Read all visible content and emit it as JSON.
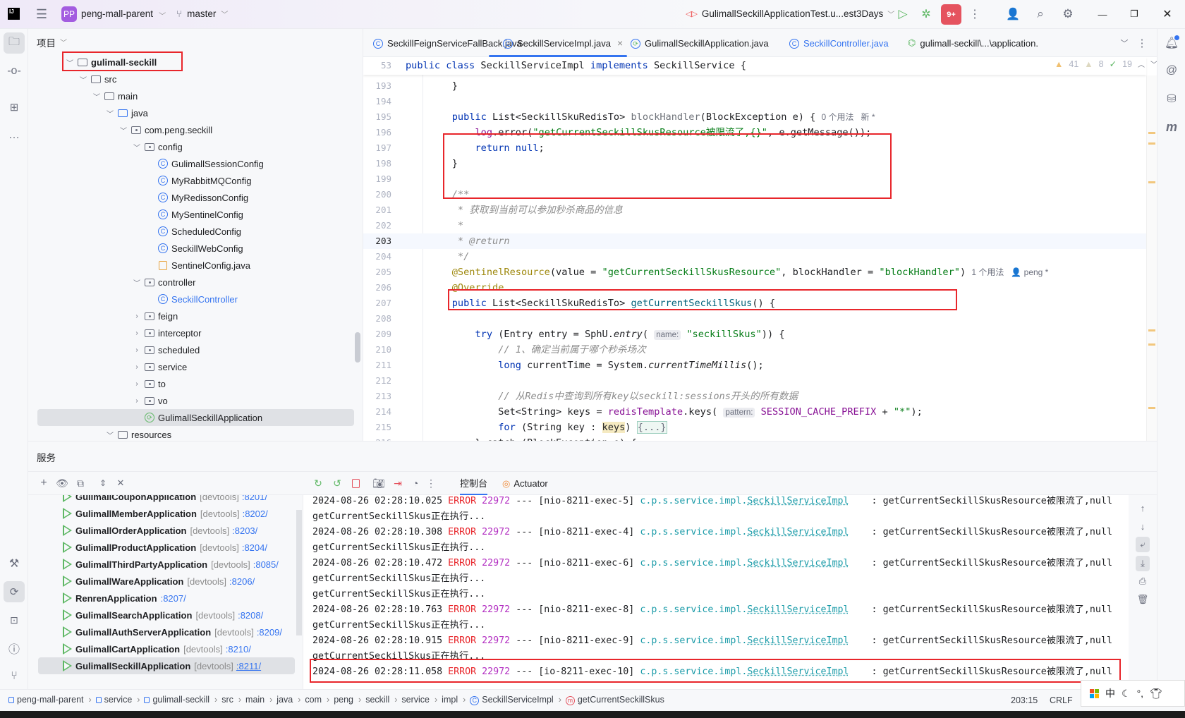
{
  "titlebar": {
    "avatar": "PP",
    "project": "peng-mall-parent",
    "branch": "master",
    "run_config": "GulimallSeckillApplicationTest.u...est3Days",
    "badge": "9+",
    "icons": [
      "intellij-logo",
      "hamburger-menu",
      "branch",
      "run",
      "debug",
      "more",
      "add-user",
      "search",
      "settings",
      "minimize",
      "restore",
      "close"
    ]
  },
  "project_panel": {
    "title": "项目",
    "tree": [
      {
        "depth": 0,
        "label": "gulimall-seckill",
        "type": "module",
        "open": true,
        "bold": true
      },
      {
        "depth": 1,
        "label": "src",
        "type": "folder",
        "open": true
      },
      {
        "depth": 2,
        "label": "main",
        "type": "folder",
        "open": true
      },
      {
        "depth": 3,
        "label": "java",
        "type": "srcfolder",
        "open": true
      },
      {
        "depth": 4,
        "label": "com.peng.seckill",
        "type": "package",
        "open": true
      },
      {
        "depth": 5,
        "label": "config",
        "type": "package",
        "open": true
      },
      {
        "depth": 6,
        "label": "GulimallSessionConfig",
        "type": "class"
      },
      {
        "depth": 6,
        "label": "MyRabbitMQConfig",
        "type": "class"
      },
      {
        "depth": 6,
        "label": "MyRedissonConfig",
        "type": "class"
      },
      {
        "depth": 6,
        "label": "MySentinelConfig",
        "type": "class"
      },
      {
        "depth": 6,
        "label": "ScheduledConfig",
        "type": "class"
      },
      {
        "depth": 6,
        "label": "SeckillWebConfig",
        "type": "class"
      },
      {
        "depth": 6,
        "label": "SentinelConfig.java",
        "type": "javafile"
      },
      {
        "depth": 5,
        "label": "controller",
        "type": "package",
        "open": true
      },
      {
        "depth": 6,
        "label": "SeckillController",
        "type": "class",
        "modified": true
      },
      {
        "depth": 5,
        "label": "feign",
        "type": "package",
        "open": false
      },
      {
        "depth": 5,
        "label": "interceptor",
        "type": "package",
        "open": false
      },
      {
        "depth": 5,
        "label": "scheduled",
        "type": "package",
        "open": false
      },
      {
        "depth": 5,
        "label": "service",
        "type": "package",
        "open": false
      },
      {
        "depth": 5,
        "label": "to",
        "type": "package",
        "open": false
      },
      {
        "depth": 5,
        "label": "vo",
        "type": "package",
        "open": false
      },
      {
        "depth": 5,
        "label": "GulimallSeckillApplication",
        "type": "springboot",
        "selected": true
      },
      {
        "depth": 3,
        "label": "resources",
        "type": "folder",
        "open": true
      }
    ]
  },
  "editor": {
    "tabs": [
      {
        "label": "SeckillFeignServiceFallBack.java",
        "icon": "class"
      },
      {
        "label": "SeckillServiceImpl.java",
        "icon": "class",
        "active": true
      },
      {
        "label": "GulimallSeckillApplication.java",
        "icon": "springboot"
      },
      {
        "label": "SeckillController.java",
        "icon": "class",
        "modified": true
      },
      {
        "label": "gulimall-seckill\\...\\application.",
        "icon": "yaml"
      }
    ],
    "inspections": {
      "warnings": "41",
      "weak_warnings": "8",
      "typos": "19"
    },
    "sticky_line": {
      "num": "53",
      "tokens": [
        [
          "public class ",
          "kw"
        ],
        [
          "SeckillServiceImpl ",
          ""
        ],
        [
          "implements ",
          "kw"
        ],
        [
          "SeckillService {",
          ""
        ]
      ]
    },
    "lines": [
      {
        "num": "193",
        "tokens": [
          [
            "    }",
            ""
          ]
        ]
      },
      {
        "num": "194",
        "tokens": []
      },
      {
        "num": "195",
        "tokens": [
          [
            "    public ",
            "kw"
          ],
          [
            "List<SeckillSkuRedisTo> ",
            ""
          ],
          [
            "blockHandler",
            "gray"
          ],
          [
            "(BlockException e) { ",
            ""
          ],
          [
            "0 个用法   新 *",
            "hintc"
          ]
        ]
      },
      {
        "num": "196",
        "tokens": [
          [
            "        ",
            ""
          ],
          [
            "log",
            "fld"
          ],
          [
            ".error(",
            ""
          ],
          [
            "\"getCurrentSeckillSkusResource被限流了,{}\"",
            "str"
          ],
          [
            ", e.getMessage());",
            ""
          ]
        ]
      },
      {
        "num": "197",
        "tokens": [
          [
            "        return null",
            "kw"
          ],
          [
            ";",
            ""
          ]
        ]
      },
      {
        "num": "198",
        "tokens": [
          [
            "    }",
            ""
          ]
        ]
      },
      {
        "num": "199",
        "tokens": []
      },
      {
        "num": "200",
        "tokens": [
          [
            "    /**",
            "cm"
          ]
        ]
      },
      {
        "num": "201",
        "tokens": [
          [
            "     * 获取到当前可以参加秒杀商品的信息",
            "cm"
          ]
        ]
      },
      {
        "num": "202",
        "tokens": [
          [
            "     *",
            "cm"
          ]
        ]
      },
      {
        "num": "203",
        "tokens": [
          [
            "     * ",
            "cm"
          ],
          [
            "@return",
            "cm"
          ]
        ],
        "current": true
      },
      {
        "num": "204",
        "tokens": [
          [
            "     */",
            "cm"
          ]
        ]
      },
      {
        "num": "205",
        "tokens": [
          [
            "    @SentinelResource",
            "ann"
          ],
          [
            "(value = ",
            ""
          ],
          [
            "\"getCurrentSeckillSkusResource\"",
            "str"
          ],
          [
            ", blockHandler = ",
            ""
          ],
          [
            "\"blockHandler\"",
            "str"
          ],
          [
            ") ",
            ""
          ],
          [
            "1 个用法   👤 peng *",
            "hintc"
          ]
        ]
      },
      {
        "num": "206",
        "tokens": [
          [
            "    @Override",
            "ann"
          ]
        ]
      },
      {
        "num": "207",
        "tokens": [
          [
            "    public ",
            "kw"
          ],
          [
            "List<SeckillSkuRedisTo> ",
            ""
          ],
          [
            "getCurrentSeckillSkus",
            "fn"
          ],
          [
            "() {",
            ""
          ]
        ]
      },
      {
        "num": "208",
        "tokens": []
      },
      {
        "num": "209",
        "tokens": [
          [
            "        try",
            "kw"
          ],
          [
            " (Entry entry = SphU.",
            ""
          ],
          [
            "entry",
            "it"
          ],
          [
            "( ",
            ""
          ],
          [
            "name:",
            "phint"
          ],
          [
            " ",
            ""
          ],
          [
            "\"seckillSkus\"",
            "str"
          ],
          [
            ")) {",
            ""
          ]
        ]
      },
      {
        "num": "210",
        "tokens": [
          [
            "            // 1、确定当前属于哪个秒杀场次",
            "cm"
          ]
        ]
      },
      {
        "num": "211",
        "tokens": [
          [
            "            long",
            "kw"
          ],
          [
            " currentTime = System.",
            ""
          ],
          [
            "currentTimeMillis",
            "it"
          ],
          [
            "();",
            ""
          ]
        ]
      },
      {
        "num": "212",
        "tokens": []
      },
      {
        "num": "213",
        "tokens": [
          [
            "            // 从Redis中查询到所有key以seckill:sessions开头的所有数据",
            "cm"
          ]
        ]
      },
      {
        "num": "214",
        "tokens": [
          [
            "            Set<String> keys = ",
            ""
          ],
          [
            "redisTemplate",
            "fld"
          ],
          [
            ".keys( ",
            ""
          ],
          [
            "pattern:",
            "phint"
          ],
          [
            " ",
            ""
          ],
          [
            "SESSION_CACHE_PREFIX",
            "fld"
          ],
          [
            " + ",
            ""
          ],
          [
            "\"*\"",
            "str"
          ],
          [
            ");",
            ""
          ]
        ]
      },
      {
        "num": "215",
        "tokens": [
          [
            "            for",
            "kw"
          ],
          [
            " (String key : ",
            ""
          ],
          [
            "keys",
            "hl"
          ],
          [
            ") ",
            ""
          ],
          [
            "{...}",
            "fold"
          ]
        ]
      },
      {
        "num": "216",
        "tokens": [
          [
            "        } catch (BlockException e) {",
            ""
          ]
        ]
      }
    ]
  },
  "services": {
    "title": "服务",
    "console_tab": "控制台",
    "actuator_tab": "Actuator",
    "apps": [
      {
        "name": "GulimallCouponApplication",
        "tag": "[devtools]",
        "port": ":8201/"
      },
      {
        "name": "GulimallMemberApplication",
        "tag": "[devtools]",
        "port": ":8202/"
      },
      {
        "name": "GulimallOrderApplication",
        "tag": "[devtools]",
        "port": ":8203/"
      },
      {
        "name": "GulimallProductApplication",
        "tag": "[devtools]",
        "port": ":8204/"
      },
      {
        "name": "GulimallThirdPartyApplication",
        "tag": "[devtools]",
        "port": ":8085/"
      },
      {
        "name": "GulimallWareApplication",
        "tag": "[devtools]",
        "port": ":8206/"
      },
      {
        "name": "RenrenApplication",
        "tag": "",
        "port": ":8207/"
      },
      {
        "name": "GulimallSearchApplication",
        "tag": "[devtools]",
        "port": ":8208/"
      },
      {
        "name": "GulimallAuthServerApplication",
        "tag": "[devtools]",
        "port": ":8209/"
      },
      {
        "name": "GulimallCartApplication",
        "tag": "[devtools]",
        "port": ":8210/"
      },
      {
        "name": "GulimallSeckillApplication",
        "tag": "[devtools]",
        "port": ":8211/",
        "selected": true
      }
    ],
    "console": [
      {
        "time": "2024-08-26 02:28:10.025",
        "level": "ERROR",
        "pid": "22972",
        "thread": "[nio-8211-exec-5]",
        "logger": "c.p.s.service.impl.",
        "cls": "SeckillServiceImpl",
        "msg": "getCurrentSeckillSkusResource被限流了,null"
      },
      {
        "text": "getCurrentSeckillSkus正在执行..."
      },
      {
        "time": "2024-08-26 02:28:10.308",
        "level": "ERROR",
        "pid": "22972",
        "thread": "[nio-8211-exec-4]",
        "logger": "c.p.s.service.impl.",
        "cls": "SeckillServiceImpl",
        "msg": "getCurrentSeckillSkusResource被限流了,null"
      },
      {
        "text": "getCurrentSeckillSkus正在执行..."
      },
      {
        "time": "2024-08-26 02:28:10.472",
        "level": "ERROR",
        "pid": "22972",
        "thread": "[nio-8211-exec-6]",
        "logger": "c.p.s.service.impl.",
        "cls": "SeckillServiceImpl",
        "msg": "getCurrentSeckillSkusResource被限流了,null"
      },
      {
        "text": "getCurrentSeckillSkus正在执行..."
      },
      {
        "text": "getCurrentSeckillSkus正在执行..."
      },
      {
        "time": "2024-08-26 02:28:10.763",
        "level": "ERROR",
        "pid": "22972",
        "thread": "[nio-8211-exec-8]",
        "logger": "c.p.s.service.impl.",
        "cls": "SeckillServiceImpl",
        "msg": "getCurrentSeckillSkusResource被限流了,null"
      },
      {
        "text": "getCurrentSeckillSkus正在执行..."
      },
      {
        "time": "2024-08-26 02:28:10.915",
        "level": "ERROR",
        "pid": "22972",
        "thread": "[nio-8211-exec-9]",
        "logger": "c.p.s.service.impl.",
        "cls": "SeckillServiceImpl",
        "msg": "getCurrentSeckillSkusResource被限流了,null"
      },
      {
        "text": "getCurrentSeckillSkus正在执行..."
      },
      {
        "time": "2024-08-26 02:28:11.058",
        "level": "ERROR",
        "pid": "22972",
        "thread": "[io-8211-exec-10]",
        "logger": "c.p.s.service.impl.",
        "cls": "SeckillServiceImpl",
        "msg": "getCurrentSeckillSkusResource被限流了,null"
      }
    ]
  },
  "statusbar": {
    "breadcrumbs": [
      "peng-mall-parent",
      "service",
      "gulimall-seckill",
      "src",
      "main",
      "java",
      "com",
      "peng",
      "seckill",
      "service",
      "impl",
      "SeckillServiceImpl",
      "getCurrentSeckillSkus"
    ],
    "position": "203:15",
    "line_ending": "CRLF",
    "ime": "中"
  },
  "colors": {
    "accent": "#3574f0",
    "highlight_box": "#e8262b",
    "error": "#e8262b",
    "run_green": "#5fb865"
  }
}
